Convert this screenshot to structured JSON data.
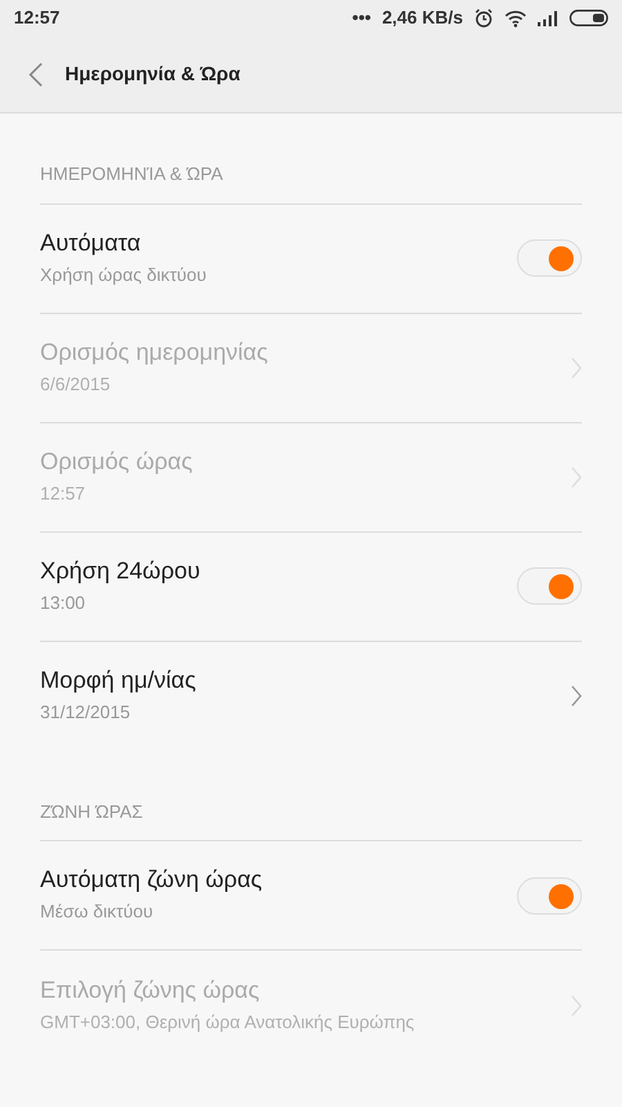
{
  "status_bar": {
    "time": "12:57",
    "dots": "•••",
    "speed": "2,46 KB/s"
  },
  "header": {
    "title": "Ημερομηνία & Ώρα"
  },
  "sections": [
    {
      "title": "ΗΜΕΡΟΜΗΝΊΑ & ΏΡΑ",
      "items": [
        {
          "kind": "toggle",
          "title": "Αυτόματα",
          "subtitle": "Χρήση ώρας δικτύου",
          "disabled": false,
          "on": true
        },
        {
          "kind": "link",
          "title": "Ορισμός ημερομηνίας",
          "subtitle": "6/6/2015",
          "disabled": true
        },
        {
          "kind": "link",
          "title": "Ορισμός ώρας",
          "subtitle": "12:57",
          "disabled": true
        },
        {
          "kind": "toggle",
          "title": "Χρήση 24ώρου",
          "subtitle": "13:00",
          "disabled": false,
          "on": true
        },
        {
          "kind": "link",
          "title": "Μορφή ημ/νίας",
          "subtitle": "31/12/2015",
          "disabled": false
        }
      ]
    },
    {
      "title": "ΖΏΝΗ ΏΡΑΣ",
      "items": [
        {
          "kind": "toggle",
          "title": "Αυτόματη ζώνη ώρας",
          "subtitle": "Μέσω δικτύου",
          "disabled": false,
          "on": true
        },
        {
          "kind": "link",
          "title": "Επιλογή ζώνης ώρας",
          "subtitle": "GMT+03:00, Θερινή ώρα Ανατολικής Ευρώπης",
          "disabled": true
        }
      ]
    }
  ]
}
